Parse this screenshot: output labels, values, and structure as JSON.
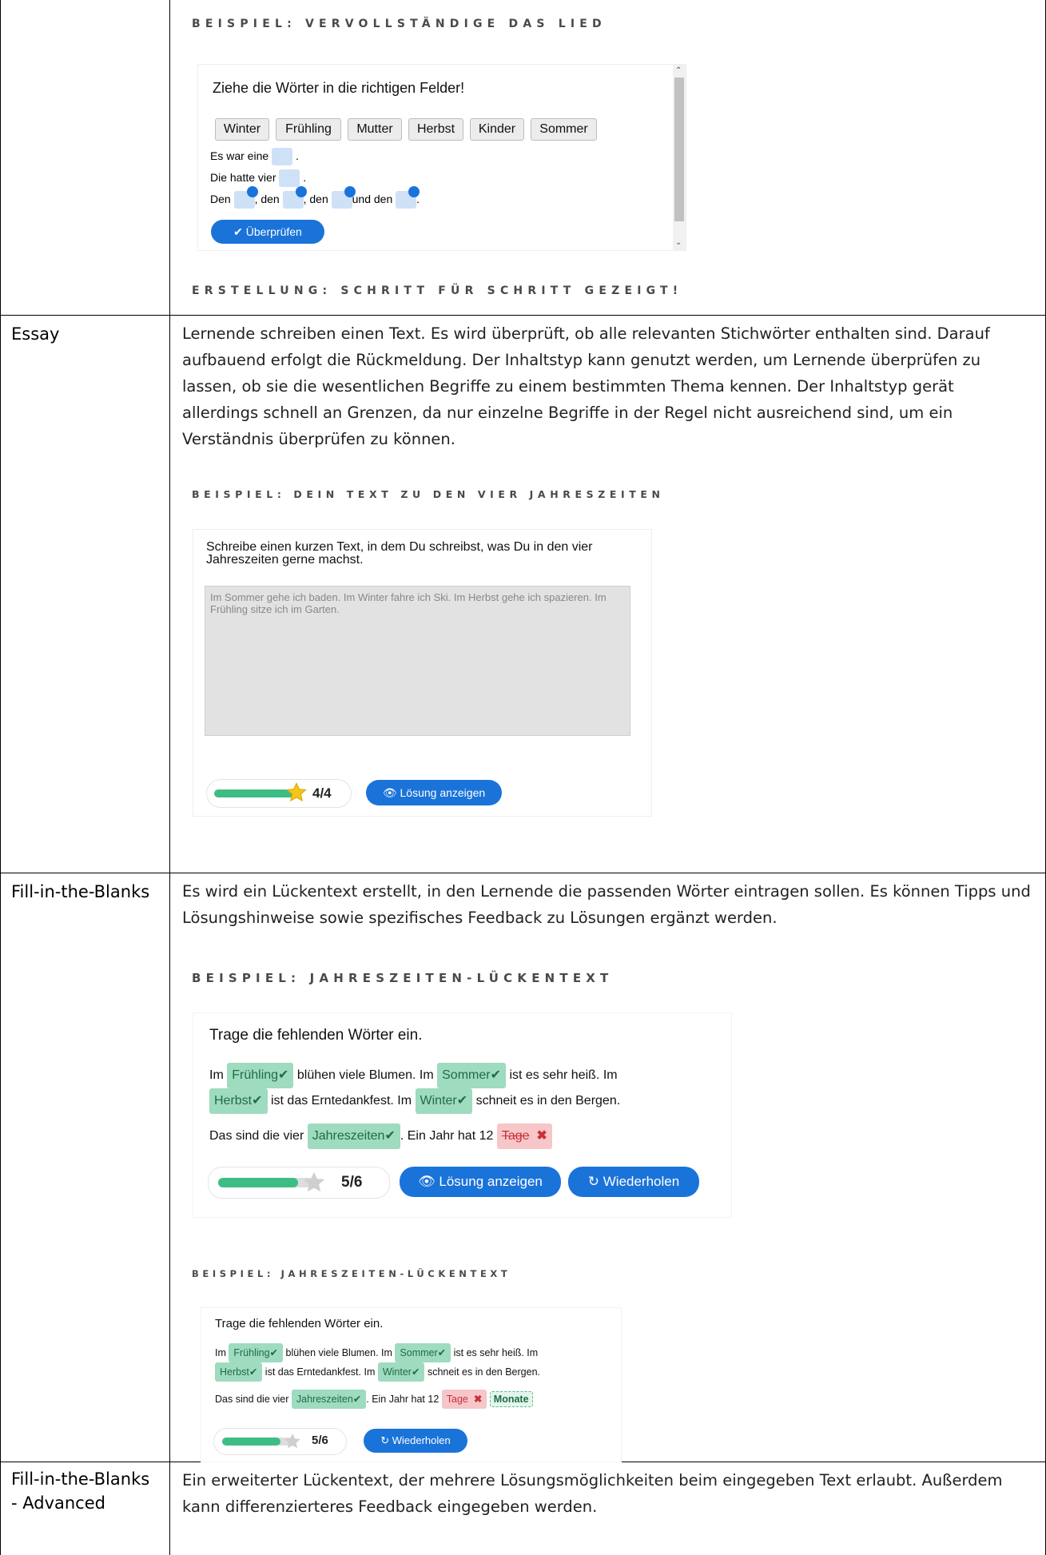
{
  "rows": [
    {
      "label": "",
      "captions": [
        "BEISPIEL: VERVOLLSTÄNDIGE DAS LIED",
        "ERSTELLUNG: SCHRITT FÜR SCHRITT GEZEIGT!"
      ]
    },
    {
      "label": "Essay",
      "text": "Lernende schreiben einen Text. Es wird überprüft, ob alle relevanten Stichwörter enthalten sind. Darauf aufbauend erfolgt die Rückmeldung. Der Inhaltstyp kann genutzt werden, um Lernende überprüfen zu lassen, ob sie die wesentlichen Begriffe zu einem bestimmten Thema kennen. Der Inhaltstyp gerät allerdings schnell an Grenzen, da nur einzelne Begriffe in der Regel nicht ausreichend sind, um ein Verständnis überprüfen zu können.",
      "caption": "BEISPIEL: DEIN TEXT ZU DEN VIER JAHRESZEITEN"
    },
    {
      "label": "Fill-in-the-Blanks",
      "text": "Es wird ein Lückentext erstellt, in den Lernende die passenden Wörter eintragen sollen. Es können Tipps und Lösungshinweise sowie spezifisches Feedback zu Lösungen ergänzt werden.",
      "caption1": "BEISPIEL: JAHRESZEITEN-LÜCKENTEXT",
      "caption2": "BEISPIEL: JAHRESZEITEN-LÜCKENTEXT"
    },
    {
      "label": "Fill-in-the-Blanks - Advanced",
      "label_line1": "Fill-in-the-Blanks",
      "label_line2": "- Advanced",
      "text": "Ein erweiterter Lückentext, der mehrere Lösungsmöglichkeiten beim eingegeben Text erlaubt. Außerdem kann differenzierteres Feedback eingegeben werden."
    }
  ],
  "drag": {
    "instruction": "Ziehe die Wörter in die richtigen Felder!",
    "words": [
      "Winter",
      "Frühling",
      "Mutter",
      "Herbst",
      "Kinder",
      "Sommer"
    ],
    "line1": "Es war eine",
    "line1_end": ".",
    "line2": "Die hatte vier",
    "line2_end": ".",
    "line3_parts": [
      "Den",
      ", den",
      ", den",
      "und den",
      "."
    ],
    "check_label": "Überprüfen"
  },
  "essay": {
    "instruction": "Schreibe einen kurzen Text, in dem Du schreibst, was Du in den vier Jahreszeiten gerne machst.",
    "answer": "Im Sommer gehe ich baden. Im Winter fahre ich Ski. Im Herbst gehe ich spazieren. Im Frühling sitze ich im Garten.",
    "score": "4/4",
    "score_fraction": 1.0,
    "solution_label": "Lösung anzeigen"
  },
  "blanks1": {
    "instruction": "Trage die fehlenden Wörter ein.",
    "s1_a": "Im",
    "w1": "Frühling",
    "s1_b": "blühen viele Blumen. Im",
    "w2": "Sommer",
    "s1_c": "ist es sehr heiß. Im",
    "w3": "Herbst",
    "s2_a": "ist das Erntedankfest. Im",
    "w4": "Winter",
    "s2_b": "schneit es in den Bergen.",
    "s3_a": "Das sind die vier",
    "w5": "Jahreszeiten",
    "s3_b": ". Ein Jahr hat 12",
    "wrong": "Tage",
    "score": "5/6",
    "score_fraction": 0.83,
    "solution_label": "Lösung anzeigen",
    "retry_label": "Wiederholen"
  },
  "blanks2": {
    "instruction": "Trage die fehlenden Wörter ein.",
    "s1_a": "Im",
    "w1": "Frühling",
    "s1_b": "blühen viele Blumen. Im",
    "w2": "Sommer",
    "s1_c": "ist es sehr heiß. Im",
    "w3": "Herbst",
    "s2_a": "ist das Erntedankfest. Im",
    "w4": "Winter",
    "s2_b": "schneit es in den Bergen.",
    "s3_a": "Das sind die vier",
    "w5": "Jahreszeiten",
    "s3_b": ". Ein Jahr hat 12",
    "wrong": "Tage",
    "correct": "Monate",
    "score": "5/6",
    "score_fraction": 0.83,
    "retry_label": "Wiederholen"
  },
  "colors": {
    "accent": "#1a73d9",
    "correct_bg": "#9edbbf",
    "wrong_bg": "#f6c6c8",
    "progress": "#3dbd84",
    "star": "#f5c518"
  }
}
